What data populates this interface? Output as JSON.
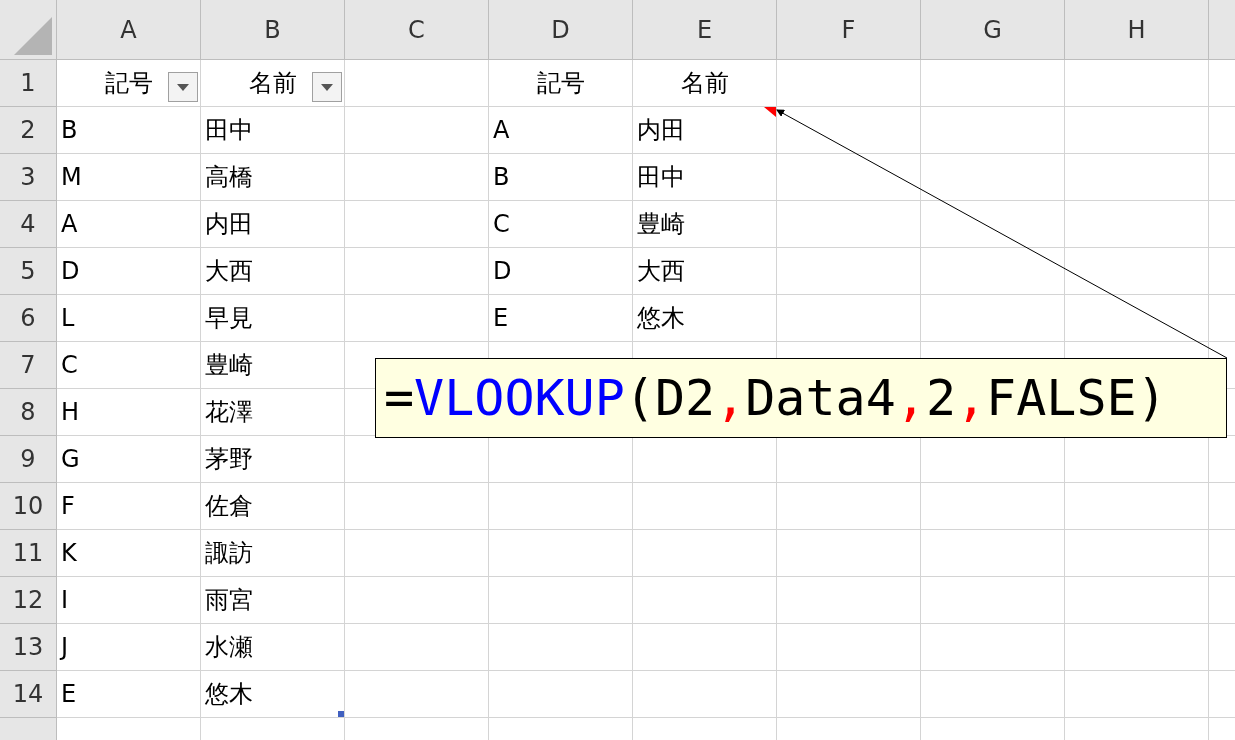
{
  "columns": [
    "A",
    "B",
    "C",
    "D",
    "E",
    "F",
    "G",
    "H"
  ],
  "header_row": {
    "number": "1",
    "a": {
      "text": "記号",
      "filter_button": true
    },
    "b": {
      "text": "名前",
      "filter_button": true
    },
    "d": {
      "text": "記号"
    },
    "e": {
      "text": "名前"
    }
  },
  "rows": [
    {
      "number": "2",
      "a": {
        "text": "B"
      },
      "b": {
        "text": "田中"
      },
      "d": {
        "text": "A"
      },
      "e": {
        "text": "内田",
        "comment": true
      }
    },
    {
      "number": "3",
      "a": {
        "text": "M"
      },
      "b": {
        "text": "高橋"
      },
      "d": {
        "text": "B"
      },
      "e": {
        "text": "田中"
      }
    },
    {
      "number": "4",
      "a": {
        "text": "A"
      },
      "b": {
        "text": "内田"
      },
      "d": {
        "text": "C"
      },
      "e": {
        "text": "豊崎"
      }
    },
    {
      "number": "5",
      "a": {
        "text": "D"
      },
      "b": {
        "text": "大西"
      },
      "d": {
        "text": "D"
      },
      "e": {
        "text": "大西"
      }
    },
    {
      "number": "6",
      "a": {
        "text": "L"
      },
      "b": {
        "text": "早見"
      },
      "d": {
        "text": "E"
      },
      "e": {
        "text": "悠木"
      }
    },
    {
      "number": "7",
      "a": {
        "text": "C"
      },
      "b": {
        "text": "豊崎"
      }
    },
    {
      "number": "8",
      "a": {
        "text": "H"
      },
      "b": {
        "text": "花澤"
      }
    },
    {
      "number": "9",
      "a": {
        "text": "G"
      },
      "b": {
        "text": "茅野"
      }
    },
    {
      "number": "10",
      "a": {
        "text": "F"
      },
      "b": {
        "text": "佐倉"
      }
    },
    {
      "number": "11",
      "a": {
        "text": "K"
      },
      "b": {
        "text": "諏訪"
      }
    },
    {
      "number": "12",
      "a": {
        "text": "I"
      },
      "b": {
        "text": "雨宮"
      }
    },
    {
      "number": "13",
      "a": {
        "text": "J"
      },
      "b": {
        "text": "水瀬"
      }
    },
    {
      "number": "14",
      "a": {
        "text": "E"
      },
      "b": {
        "text": "悠木",
        "table_end": true
      }
    }
  ],
  "callout": {
    "parts": [
      {
        "text": "=",
        "kind": "plain"
      },
      {
        "text": "VLOOKUP",
        "kind": "function"
      },
      {
        "text": "(D2",
        "kind": "plain"
      },
      {
        "text": ",",
        "kind": "separator"
      },
      {
        "text": "Data4",
        "kind": "plain"
      },
      {
        "text": ",",
        "kind": "separator"
      },
      {
        "text": "2",
        "kind": "plain"
      },
      {
        "text": ",",
        "kind": "separator"
      },
      {
        "text": "FALSE)",
        "kind": "plain"
      }
    ]
  }
}
